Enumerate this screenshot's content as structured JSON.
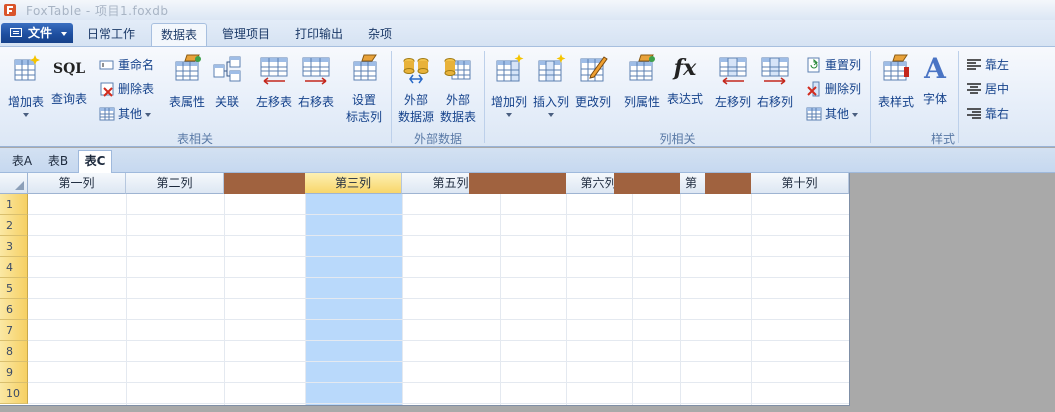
{
  "window": {
    "title": "FoxTable - 项目1.foxdb"
  },
  "file_menu": {
    "label": "文件"
  },
  "tabs": [
    {
      "label": "日常工作"
    },
    {
      "label": "数据表"
    },
    {
      "label": "管理项目"
    },
    {
      "label": "打印输出"
    },
    {
      "label": "杂项"
    }
  ],
  "ribbon": {
    "table_group": {
      "label": "表相关",
      "add_table": "增加表",
      "query_table": "查询表",
      "rename": "重命名",
      "delete_table": "删除表",
      "other": "其他",
      "table_props": "表属性",
      "relation": "关联",
      "move_left": "左移表",
      "move_right": "右移表",
      "set_flag_col_1": "设置",
      "set_flag_col_2": "标志列",
      "sql_icon_text": "SQL"
    },
    "external_group": {
      "label": "外部数据",
      "ext_source_1": "外部",
      "ext_source_2": "数据源",
      "ext_table_1": "外部",
      "ext_table_2": "数据表"
    },
    "column_group": {
      "label": "列相关",
      "add_col": "增加列",
      "insert_col": "插入列",
      "change_col": "更改列",
      "col_props": "列属性",
      "expression": "表达式",
      "col_left": "左移列",
      "col_right": "右移列",
      "reset_col": "重置列",
      "delete_col": "删除列",
      "other": "其他",
      "fx_text": "fx"
    },
    "style_group": {
      "label": "样式",
      "table_style": "表样式",
      "font": "字体",
      "align_left": "靠左",
      "align_center": "居中",
      "align_right": "靠右",
      "font_icon_text": "A"
    }
  },
  "sheet_tabs": [
    {
      "label": "表A"
    },
    {
      "label": "表B"
    },
    {
      "label": "表C"
    }
  ],
  "grid": {
    "columns": [
      "第一列",
      "第二列",
      "第三列",
      "第五列",
      "第六列",
      "第",
      "第十列"
    ],
    "rows": [
      "1",
      "2",
      "3",
      "4",
      "5",
      "6",
      "7",
      "8",
      "9",
      "10"
    ],
    "selected_column": "第三列"
  },
  "colors": {
    "accent": "#1e4fa0",
    "selected_header": "#f8d66a",
    "selected_column": "#b9d9fb",
    "redaction": "#a0623f"
  }
}
